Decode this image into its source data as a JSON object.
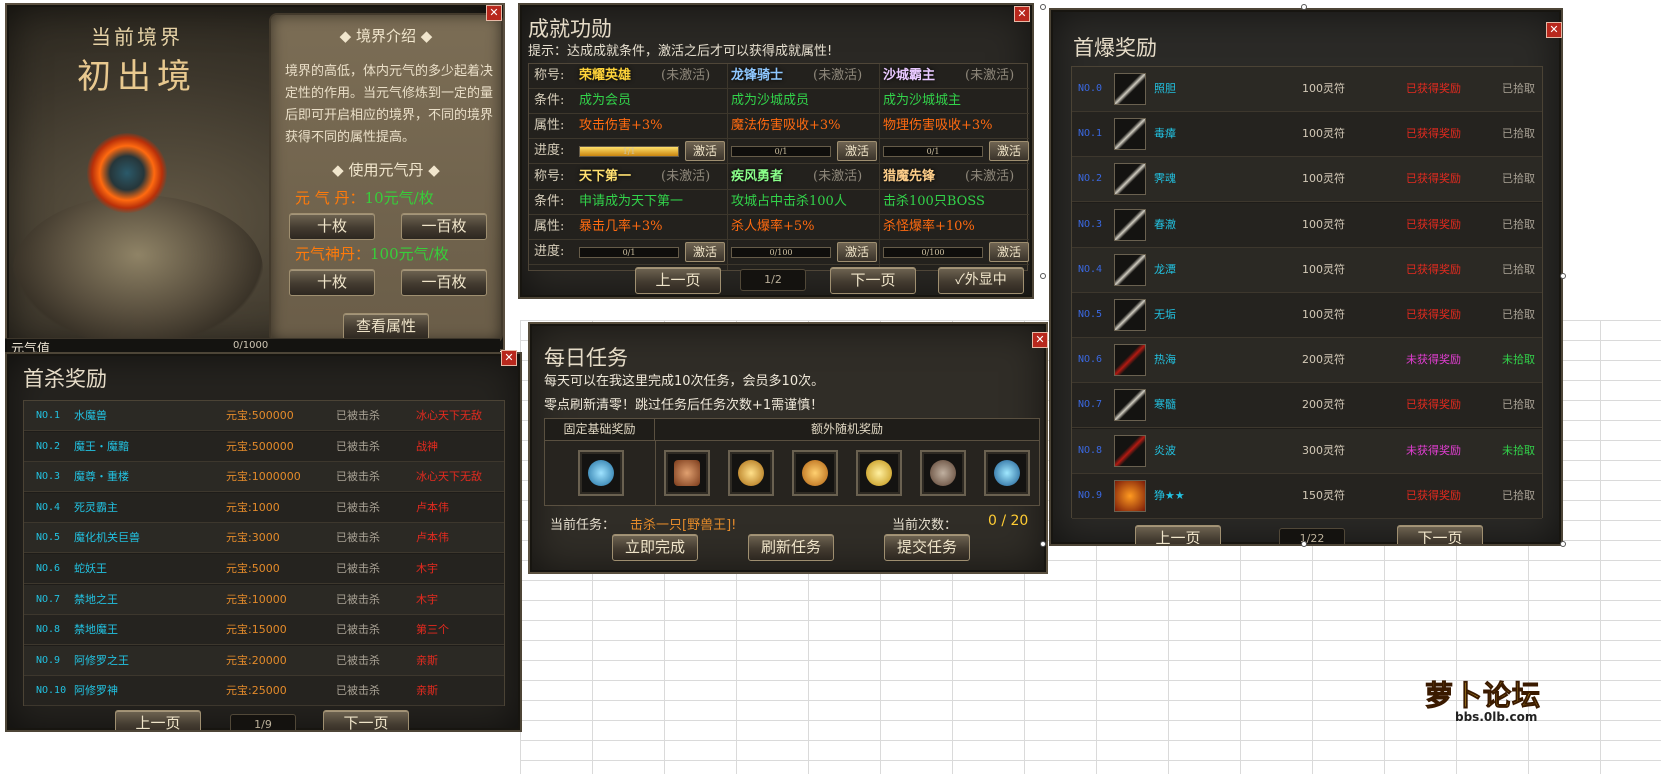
{
  "colors": {
    "cyan": "#22c1e0",
    "orange": "#e38a2a",
    "red": "#e52a1f",
    "magenta": "#e43ed4",
    "green": "#32d24a",
    "gold": "#ffcc33"
  },
  "realm": {
    "label_top": "当前境界",
    "label_realm": "初出境",
    "intro_title": "境界介绍",
    "intro_text": "境界的高低，体内元气的多少起着决定性的作用。当元气修炼到一定的量后即可开启相应的境界，不同的境界获得不同的属性提高。",
    "use_title": "使用元气丹",
    "pill1_label": "元 气 丹：",
    "pill1_price": "10元气/枚",
    "pill2_label": "元气神丹：",
    "pill2_price": "100元气/枚",
    "btn_ten": "十枚",
    "btn_hundred": "一百枚",
    "btn_view": "查看属性",
    "value_label": "元气值",
    "value_text": "0/1000"
  },
  "first_kill": {
    "title": "首杀奖励",
    "rows": [
      {
        "no": "NO.1",
        "name": "水魔兽",
        "reward": "元宝:500000",
        "status": "已被击杀",
        "killer": "冰心天下无敌"
      },
      {
        "no": "NO.2",
        "name": "魔王・魔黯",
        "reward": "元宝:500000",
        "status": "已被击杀",
        "killer": "战神"
      },
      {
        "no": "NO.3",
        "name": "魔尊・重楼",
        "reward": "元宝:1000000",
        "status": "已被击杀",
        "killer": "冰心天下无敌"
      },
      {
        "no": "NO.4",
        "name": "死灵霸主",
        "reward": "元宝:1000",
        "status": "已被击杀",
        "killer": "卢本伟"
      },
      {
        "no": "NO.5",
        "name": "魔化机关巨兽",
        "reward": "元宝:3000",
        "status": "已被击杀",
        "killer": "卢本伟"
      },
      {
        "no": "NO.6",
        "name": "蛇妖王",
        "reward": "元宝:5000",
        "status": "已被击杀",
        "killer": "木宇"
      },
      {
        "no": "NO.7",
        "name": "禁地之王",
        "reward": "元宝:10000",
        "status": "已被击杀",
        "killer": "木宇"
      },
      {
        "no": "NO.8",
        "name": "禁地魔王",
        "reward": "元宝:15000",
        "status": "已被击杀",
        "killer": "第三个"
      },
      {
        "no": "NO.9",
        "name": "阿修罗之王",
        "reward": "元宝:20000",
        "status": "已被击杀",
        "killer": "亲斯"
      },
      {
        "no": "NO.10",
        "name": "阿修罗神",
        "reward": "元宝:25000",
        "status": "已被击杀",
        "killer": "亲斯"
      }
    ],
    "prev": "上一页",
    "page": "1/9",
    "next": "下一页"
  },
  "achievement": {
    "title": "成就功勋",
    "hint": "提示：达成成就条件，激活之后才可以获得成就属性!",
    "label_title": "称号:",
    "label_cond": "条件:",
    "label_attr": "属性:",
    "label_prog": "进度:",
    "inactive": "(未激活)",
    "activate": "激活",
    "blocks": [
      {
        "titles": [
          "荣耀英雄",
          "龙锋骑士",
          "沙城霸主"
        ],
        "conds": [
          "成为会员",
          "成为沙城成员",
          "成为沙城城主"
        ],
        "attrs": [
          "攻击伤害+3%",
          "魔法伤害吸收+3%",
          "物理伤害吸收+3%"
        ],
        "progress": [
          "1/1",
          "0/1",
          "0/1"
        ],
        "fill": [
          1,
          0,
          0
        ]
      },
      {
        "titles": [
          "天下第一",
          "疾风勇者",
          "猎魔先锋"
        ],
        "conds": [
          "申请成为天下第一",
          "攻城占中击杀100人",
          "击杀100只BOSS"
        ],
        "attrs": [
          "暴击几率+3%",
          "杀人爆率+5%",
          "杀怪爆率+10%"
        ],
        "progress": [
          "0/1",
          "0/100",
          "0/100"
        ],
        "fill": [
          0,
          0,
          0
        ]
      }
    ],
    "prev": "上一页",
    "page": "1/2",
    "next": "下一页",
    "show": "✓外显中"
  },
  "daily": {
    "title": "每日任务",
    "line1": "每天可以在我这里完成10次任务，会员多10次。",
    "line2": "零点刷新清零！跳过任务后任务次数+1需谨慎！",
    "fixed_label": "固定基础奖励",
    "extra_label": "额外随机奖励",
    "current_task_label": "当前任务：",
    "current_task": "击杀一只[野兽王]!",
    "count_label": "当前次数：",
    "count": "0 / 20",
    "btn_complete": "立即完成",
    "btn_refresh": "刷新任务",
    "btn_submit": "提交任务"
  },
  "first_drop": {
    "title": "首爆奖励",
    "rows": [
      {
        "no": "NO.0",
        "name": "照胆",
        "reward": "100灵符",
        "status": "已获得奖励",
        "picked": "已拾取"
      },
      {
        "no": "NO.1",
        "name": "毒瘴",
        "reward": "100灵符",
        "status": "已获得奖励",
        "picked": "已拾取"
      },
      {
        "no": "NO.2",
        "name": "霁魂",
        "reward": "100灵符",
        "status": "已获得奖励",
        "picked": "已拾取"
      },
      {
        "no": "NO.3",
        "name": "春澈",
        "reward": "100灵符",
        "status": "已获得奖励",
        "picked": "已拾取"
      },
      {
        "no": "NO.4",
        "name": "龙潭",
        "reward": "100灵符",
        "status": "已获得奖励",
        "picked": "已拾取"
      },
      {
        "no": "NO.5",
        "name": "无垢",
        "reward": "100灵符",
        "status": "已获得奖励",
        "picked": "已拾取"
      },
      {
        "no": "NO.6",
        "name": "热海",
        "reward": "200灵符",
        "status": "未获得奖励",
        "picked": "未拾取"
      },
      {
        "no": "NO.7",
        "name": "寒髓",
        "reward": "200灵符",
        "status": "已获得奖励",
        "picked": "已拾取"
      },
      {
        "no": "NO.8",
        "name": "炎波",
        "reward": "300灵符",
        "status": "未获得奖励",
        "picked": "未拾取"
      },
      {
        "no": "NO.9",
        "name": "狰★★",
        "reward": "150灵符",
        "status": "已获得奖励",
        "picked": "已拾取"
      }
    ],
    "prev": "上一页",
    "page": "1/22",
    "next": "下一页"
  },
  "watermark": {
    "brand": "萝卜论坛",
    "url": "bbs.0lb.com"
  }
}
